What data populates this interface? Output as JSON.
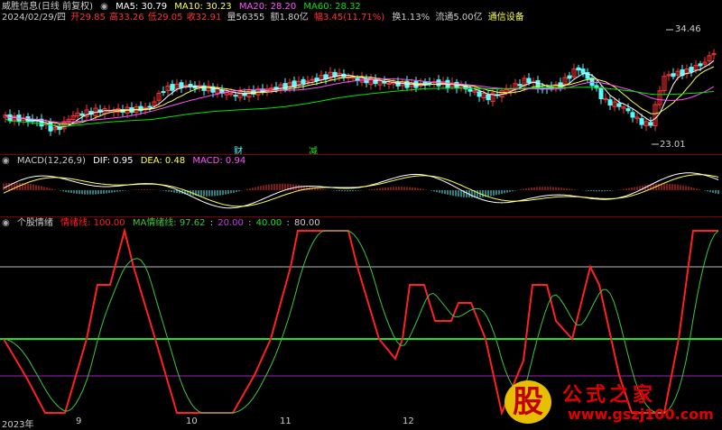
{
  "price_header": {
    "stock_name": "威胜信息(日线 前复权)",
    "ma5": "MA5: 30.79",
    "ma10": "MA10: 30.23",
    "ma20": "MA20: 28.20",
    "ma60": "MA60: 28.32"
  },
  "quote_line": {
    "date": "2024/02/29/四",
    "open": "开29.85",
    "high": "高33.26",
    "low": "低29.05",
    "close": "收32.91",
    "volume": "量56355",
    "amount": "额1.80亿",
    "change": "幅3.45(11.71%)",
    "turnover": "换1.13%",
    "float": "流通5.00亿",
    "industry": "通信设备"
  },
  "price_labels": {
    "high": "34.46",
    "low": "23.01"
  },
  "badges": {
    "cai": "财",
    "jian": "减"
  },
  "macd_header": {
    "name": "MACD(12,26,9)",
    "dif": "DIF: 0.95",
    "dea": "DEA: 0.48",
    "macd": "MACD: 0.94"
  },
  "mood_header": {
    "name": "个股情绪",
    "line": "情绪线: 100.00",
    "ma": "MA情绪线: 97.62",
    "l20": "20.00",
    "l40": "40.00",
    "l80": "80.00"
  },
  "x_labels": [
    "2023年",
    "9",
    "10",
    "11",
    "12"
  ],
  "watermark": {
    "logo": "股",
    "title": "公式之家",
    "url": "www.gszj100.com"
  },
  "colors": {
    "up": "#ff3232",
    "down": "#54ffff",
    "ma5": "#ffffff",
    "ma10": "#ffff54",
    "ma20": "#ff54ff",
    "ma60": "#00e600",
    "mood": "#ff2020",
    "mood_ma": "#3cc83c",
    "l20": "#a020c0",
    "l40": "#20e020",
    "l80": "#bbbbbb"
  }
}
